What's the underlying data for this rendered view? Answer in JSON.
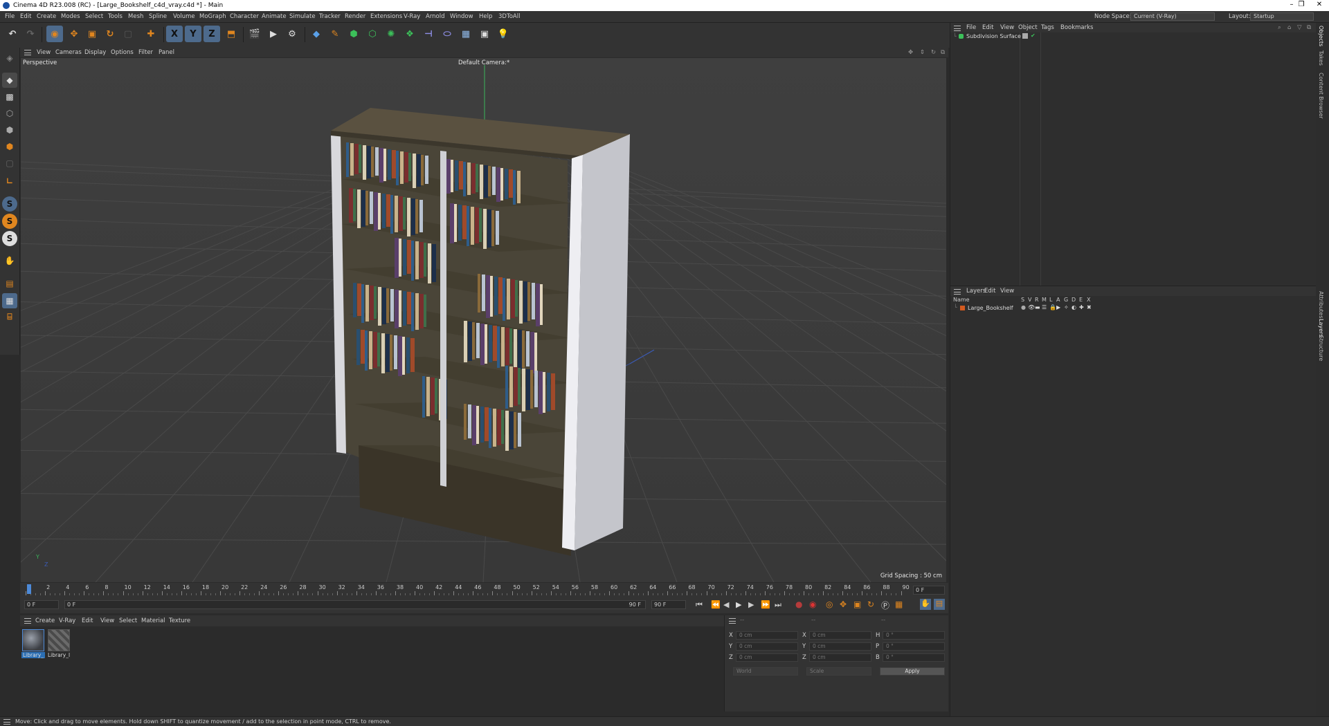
{
  "window": {
    "title": "Cinema 4D R23.008 (RC) - [Large_Bookshelf_c4d_vray.c4d *] - Main",
    "minimize": "–",
    "restore": "❐",
    "close": "✕"
  },
  "menubar": {
    "items": [
      "File",
      "Edit",
      "Create",
      "Modes",
      "Select",
      "Tools",
      "Mesh",
      "Spline",
      "Volume",
      "MoGraph",
      "Character",
      "Animate",
      "Simulate",
      "Tracker",
      "Render",
      "Extensions",
      "V-Ray",
      "Arnold",
      "Window",
      "Help",
      "3DToAll"
    ],
    "node_space_label": "Node Space:",
    "node_space_value": "Current (V-Ray)",
    "layout_label": "Layout:",
    "layout_value": "Startup"
  },
  "toolbar": {
    "axis_x": "X",
    "axis_y": "Y",
    "axis_z": "Z",
    "icons": [
      "undo-icon",
      "redo-icon",
      "select-icon",
      "move-icon",
      "scale-icon",
      "rotate-icon",
      "live-select-icon",
      "add-object-icon",
      "axis-x-icon",
      "axis-y-icon",
      "axis-z-icon",
      "coordinate-system-icon",
      "render-region-icon",
      "render-view-icon",
      "render-settings-icon",
      "cube-icon",
      "pen-icon",
      "subdivision-icon",
      "extrude-icon",
      "array-icon",
      "cloner-icon",
      "deformer-icon",
      "field-icon",
      "floor-icon",
      "camera-icon",
      "light-icon"
    ]
  },
  "left_tools": {
    "s_labels": [
      "S",
      "S",
      "S"
    ]
  },
  "viewport": {
    "menu": [
      "View",
      "Cameras",
      "Display",
      "Options",
      "Filter",
      "Panel"
    ],
    "projection": "Perspective",
    "camera": "Default Camera",
    "camera_marker": ":*",
    "grid_spacing": "Grid Spacing : 50 cm",
    "axis_labels": {
      "y": "Y",
      "z": "Z"
    }
  },
  "timeline": {
    "ticks": [
      "0",
      "2",
      "4",
      "6",
      "8",
      "10",
      "12",
      "14",
      "16",
      "18",
      "20",
      "22",
      "24",
      "26",
      "28",
      "30",
      "32",
      "34",
      "36",
      "38",
      "40",
      "42",
      "44",
      "46",
      "48",
      "50",
      "52",
      "54",
      "56",
      "58",
      "60",
      "62",
      "64",
      "66",
      "68",
      "70",
      "72",
      "74",
      "76",
      "78",
      "80",
      "82",
      "84",
      "86",
      "88",
      "90"
    ],
    "current_frame": "0 F",
    "start_frame": "0 F",
    "range_start": "0 F",
    "range_end": "90 F",
    "end_frame": "90 F"
  },
  "material_manager": {
    "menu": [
      "Create",
      "V-Ray",
      "Edit",
      "View",
      "Select",
      "Material",
      "Texture"
    ],
    "materials": [
      {
        "label": "Library_"
      },
      {
        "label": "Library_l"
      }
    ]
  },
  "coordinates": {
    "header": [
      "--",
      "--",
      "--"
    ],
    "rows": [
      {
        "a": "X",
        "av": "0 cm",
        "b": "X",
        "bv": "0 cm",
        "c": "H",
        "cv": "0 °"
      },
      {
        "a": "Y",
        "av": "0 cm",
        "b": "Y",
        "bv": "0 cm",
        "c": "P",
        "cv": "0 °"
      },
      {
        "a": "Z",
        "av": "0 cm",
        "b": "Z",
        "bv": "0 cm",
        "c": "B",
        "cv": "0 °"
      }
    ],
    "world": "World",
    "scale": "Scale",
    "apply": "Apply"
  },
  "status": "Move: Click and drag to move elements. Hold down SHIFT to quantize movement / add to the selection in point mode, CTRL to remove.",
  "object_manager": {
    "menu": [
      "File",
      "Edit",
      "View",
      "Object",
      "Tags",
      "Bookmarks"
    ],
    "objects": [
      {
        "name": "Subdivision Surface"
      }
    ]
  },
  "layer_manager": {
    "menu": [
      "Layers",
      "Edit",
      "View"
    ],
    "columns": [
      "Name",
      "S",
      "V",
      "R",
      "M",
      "L",
      "A",
      "G",
      "D",
      "E",
      "X"
    ],
    "layers": [
      {
        "name": "Large_Bookshelf",
        "color": "#d35a1f"
      }
    ]
  },
  "side_tabs": [
    "Objects",
    "Takes",
    "Content Browser",
    "Attributes",
    "Layers",
    "Structure"
  ],
  "colors": {
    "accent_blue": "#2b6fb5",
    "axis_orange": "#e0861f",
    "bg_panel": "#333333",
    "viewport_bg": "#3b3b3b"
  }
}
